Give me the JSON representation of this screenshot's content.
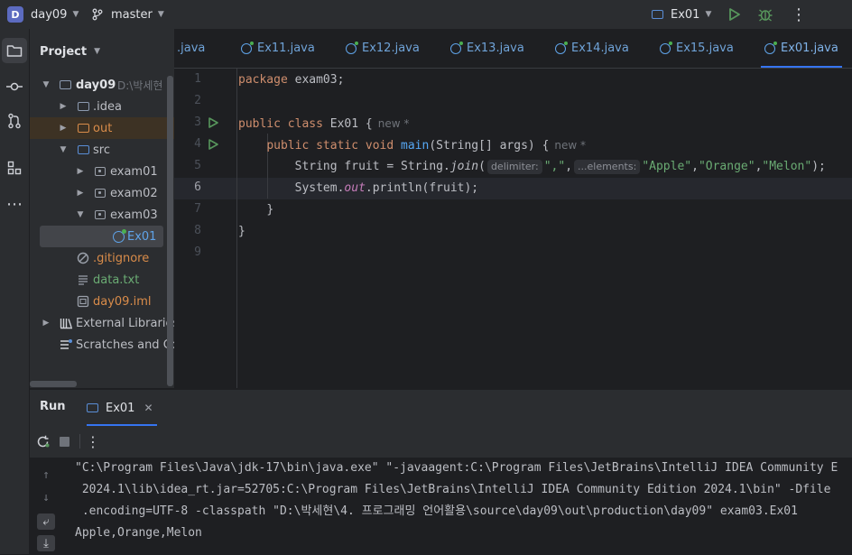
{
  "titlebar": {
    "project_badge": "D",
    "project_name": "day09",
    "branch_name": "master",
    "run_config": "Ex01"
  },
  "project_panel": {
    "title": "Project",
    "tree": [
      {
        "label": "day09",
        "suffix": "D:\\박세현"
      },
      {
        "label": ".idea"
      },
      {
        "label": "out"
      },
      {
        "label": "src"
      },
      {
        "label": "exam01"
      },
      {
        "label": "exam02"
      },
      {
        "label": "exam03"
      },
      {
        "label": "Ex01"
      },
      {
        "label": ".gitignore"
      },
      {
        "label": "data.txt"
      },
      {
        "label": "day09.iml"
      },
      {
        "label": "External Libraries"
      },
      {
        "label": "Scratches and Con"
      }
    ]
  },
  "tabs": [
    {
      "label": ".java"
    },
    {
      "label": "Ex11.java"
    },
    {
      "label": "Ex12.java"
    },
    {
      "label": "Ex13.java"
    },
    {
      "label": "Ex14.java"
    },
    {
      "label": "Ex15.java"
    },
    {
      "label": "Ex01.java",
      "active": true
    }
  ],
  "editor": {
    "line_numbers": [
      "1",
      "2",
      "3",
      "4",
      "5",
      "6",
      "7",
      "8",
      "9"
    ],
    "current_line": 6,
    "code": {
      "l1_kw": "package",
      "l1_rest": " exam03;",
      "l3_kw": "public class",
      "l3_rest": " Ex01 {",
      "l3_author": "new *",
      "l4_kw": "public static void",
      "l4_fn": "main",
      "l4_rest": "(String[] args) {",
      "l4_author": "new *",
      "l5_a": "String fruit = String.",
      "l5_join": "join",
      "l5_paren": "(",
      "l5_hint1": "delimiter:",
      "l5_str1": "\",\"",
      "l5_comma": ",",
      "l5_hint2": "...elements:",
      "l5_str2": "\"Apple\"",
      "l5_str3": "\"Orange\"",
      "l5_str4": "\"Melon\"",
      "l5_end": ");",
      "l6_a": "System.",
      "l6_out": "out",
      "l6_b": ".println(fruit);",
      "l7": "}",
      "l8": "}"
    }
  },
  "run_panel": {
    "title": "Run",
    "tab_label": "Ex01",
    "console_lines": [
      "\"C:\\Program Files\\Java\\jdk-17\\bin\\java.exe\" \"-javaagent:C:\\Program Files\\JetBrains\\IntelliJ IDEA Community E",
      " 2024.1\\lib\\idea_rt.jar=52705:C:\\Program Files\\JetBrains\\IntelliJ IDEA Community Edition 2024.1\\bin\" -Dfile",
      " .encoding=UTF-8 -classpath \"D:\\박세현\\4. 프로그래밍 언어활용\\source\\day09\\out\\production\\day09\" exam03.Ex01",
      "Apple,Orange,Melon"
    ]
  },
  "colors": {
    "accent": "#3574f0",
    "run_green": "#57965c",
    "string_green": "#6aab73",
    "keyword_orange": "#cf8e6d",
    "function_blue": "#56a8f5",
    "field_purple": "#c77dbb"
  }
}
